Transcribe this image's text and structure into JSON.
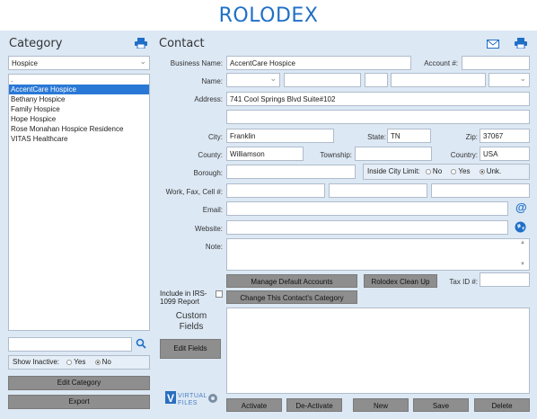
{
  "app_title": "ROLODEX",
  "category": {
    "heading": "Category",
    "dropdown_value": "Hospice",
    "list_items": [
      ".",
      "AccentCare Hospice",
      "Bethany Hospice",
      "Family Hospice",
      "Hope Hospice",
      "Rose Monahan Hospice Residence",
      "VITAS Healthcare"
    ],
    "selected_index": 1,
    "search_value": "",
    "show_inactive_label": "Show Inactive:",
    "yes_label": "Yes",
    "no_label": "No",
    "show_inactive_selected": "No",
    "edit_category_label": "Edit Category",
    "export_label": "Export"
  },
  "contact": {
    "heading": "Contact",
    "business_name_label": "Business Name:",
    "business_name_value": "AccentCare Hospice",
    "account_label": "Account #:",
    "account_value": "",
    "name_label": "Name:",
    "address_label": "Address:",
    "address_line1": "741 Cool Springs Blvd Suite#102",
    "address_line2": "",
    "city_label": "City:",
    "city_value": "Franklin",
    "state_label": "State:",
    "state_value": "TN",
    "zip_label": "Zip:",
    "zip_value": "37067",
    "county_label": "County:",
    "county_value": "Williamson",
    "township_label": "Township:",
    "township_value": "",
    "country_label": "Country:",
    "country_value": "USA",
    "borough_label": "Borough:",
    "borough_value": "",
    "inside_city_label": "Inside City Limit:",
    "inside_no": "No",
    "inside_yes": "Yes",
    "inside_unk": "Unk.",
    "inside_selected": "Unk.",
    "phones_label": "Work, Fax, Cell #:",
    "email_label": "Email:",
    "website_label": "Website:",
    "note_label": "Note:",
    "manage_defaults_label": "Manage Default Accounts",
    "rolodex_cleanup_label": "Rolodex Clean Up",
    "tax_id_label": "Tax ID #:",
    "include_irs_label": "Include in IRS-1099 Report",
    "change_category_label": "Change This Contact's Category",
    "custom_fields_label": "Custom Fields",
    "edit_fields_label": "Edit Fields"
  },
  "footer": {
    "logo_text": "VIRTUAL FILES",
    "activate_label": "Activate",
    "deactivate_label": "De-Activate",
    "new_label": "New",
    "save_label": "Save",
    "delete_label": "Delete"
  },
  "icons": {
    "print": "printer-icon",
    "mail": "envelope-icon",
    "email_at": "at-icon",
    "website": "globe-icon",
    "search": "search-icon"
  }
}
